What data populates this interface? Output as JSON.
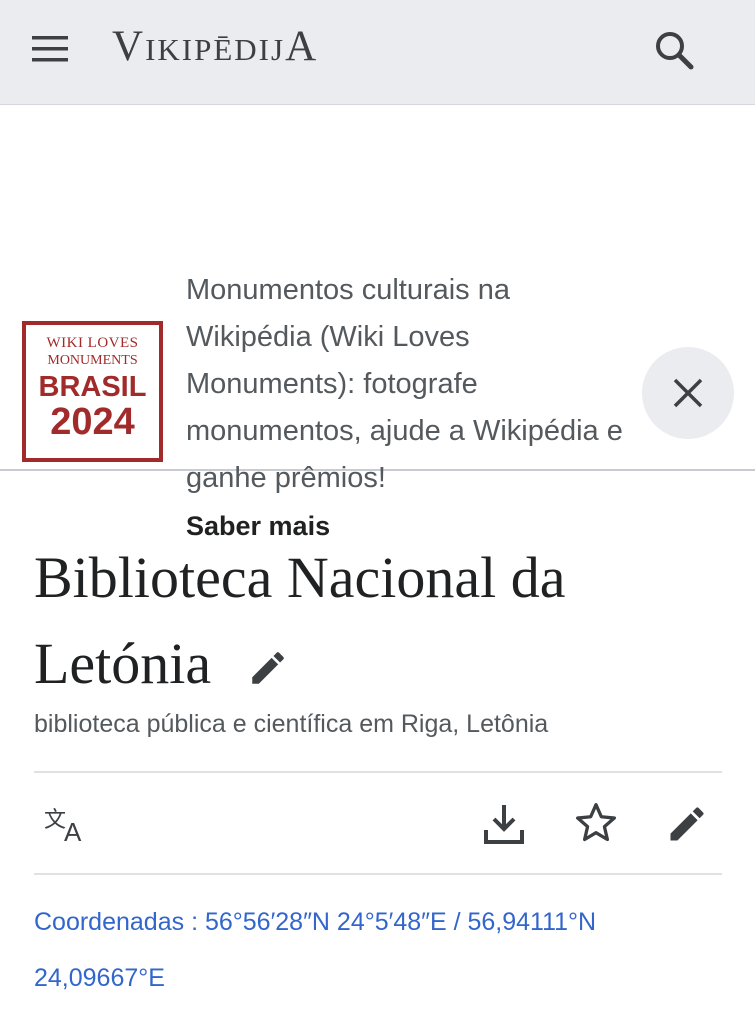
{
  "header": {
    "brand": {
      "first": "V",
      "mid": "IKIPĒDIJ",
      "last": "A"
    },
    "menu_icon": "hamburger-menu-icon",
    "search_icon": "search-icon"
  },
  "banner": {
    "logo": {
      "line1": "WIKI LOVES",
      "line2": "MONUMENTS",
      "line3": "BRASIL",
      "line4": "2024",
      "color": "#a12a2a"
    },
    "text": "Monumentos culturais na Wikipédia (Wiki Loves Monuments): fotografe monumentos, ajude a Wikipédia e ganhe prêmios!",
    "link": "Saber mais",
    "close_icon": "close-icon"
  },
  "article": {
    "title": "Biblioteca Nacional da Letónia",
    "description": "biblioteca pública e científica em Riga, Letônia"
  },
  "actions": {
    "language_icon": "language-icon",
    "download_icon": "download-icon",
    "watch_icon": "star-icon",
    "edit_icon": "pencil-icon"
  },
  "coordinates": {
    "label": "Coordenadas",
    "separator": " : ",
    "dms": "56°56′28″N 24°5′48″E",
    "slash": " / ",
    "decimal": "56,94111°N 24,09667°E"
  },
  "colors": {
    "link": "#3366cc",
    "header_bg": "#eaecf0"
  }
}
